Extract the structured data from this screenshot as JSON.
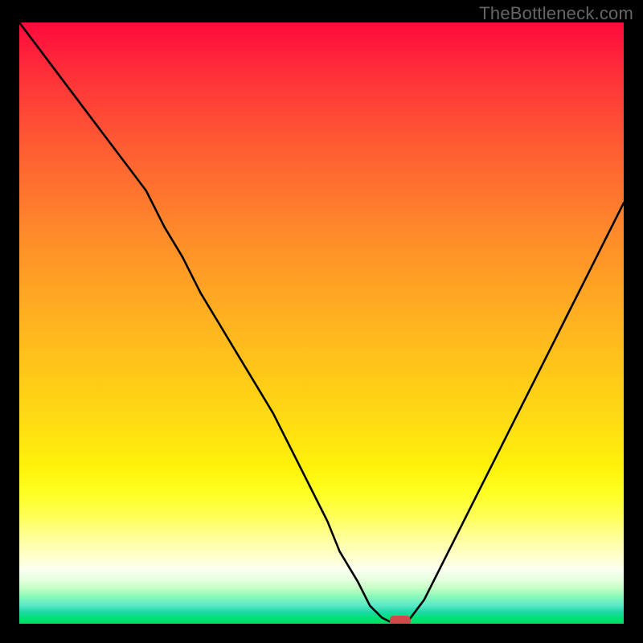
{
  "watermark": "TheBottleneck.com",
  "chart_data": {
    "type": "line",
    "title": "",
    "xlabel": "",
    "ylabel": "",
    "xlim": [
      0,
      100
    ],
    "ylim": [
      0,
      100
    ],
    "x": [
      0,
      3,
      6,
      9,
      12,
      15,
      18,
      21,
      24,
      27,
      30,
      33,
      36,
      39,
      42,
      45,
      48,
      51,
      53,
      56,
      58,
      60,
      62,
      64,
      67,
      70,
      73,
      76,
      79,
      82,
      85,
      88,
      91,
      94,
      97,
      100
    ],
    "values": [
      100,
      96,
      92,
      88,
      84,
      80,
      76,
      72,
      66,
      61,
      55,
      50,
      45,
      40,
      35,
      29,
      23,
      17,
      12,
      7,
      3,
      1,
      0,
      0,
      4,
      10,
      16,
      22,
      28,
      34,
      40,
      46,
      52,
      58,
      64,
      70
    ],
    "marker_min": {
      "x": 63,
      "y": 0
    },
    "background_scale": "rainbow vertical (red top → green bottom)"
  }
}
